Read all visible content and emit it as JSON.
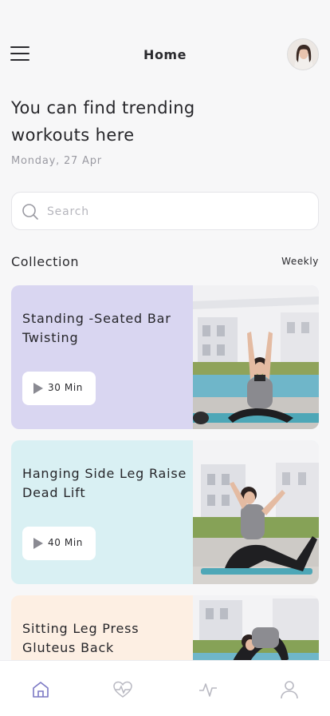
{
  "header": {
    "title": "Home"
  },
  "hero": {
    "headline": "You can find trending workouts here",
    "date": "Monday, 27 Apr"
  },
  "search": {
    "placeholder": "Search",
    "value": ""
  },
  "collection": {
    "title": "Collection",
    "filter": "Weekly",
    "cards": [
      {
        "title": "Standing -Seated Bar Twisting",
        "duration": "30 Min",
        "color": "#d9d6f1"
      },
      {
        "title": "Hanging Side Leg Raise Dead Lift",
        "duration": "40 Min",
        "color": "#d9f0f3"
      },
      {
        "title": "Sitting Leg Press Gluteus Back",
        "duration": "",
        "color": "#fdefe3"
      }
    ]
  },
  "tabbar": {
    "items": [
      {
        "icon": "home-icon",
        "active": true
      },
      {
        "icon": "heart-pulse-icon",
        "active": false
      },
      {
        "icon": "activity-icon",
        "active": false
      },
      {
        "icon": "profile-icon",
        "active": false
      }
    ],
    "active_color": "#7b78c4",
    "inactive_color": "#b9b9c2"
  },
  "colors": {
    "background": "#f7f7f8",
    "text": "#2a2a2e",
    "muted": "#9a9aa2"
  }
}
